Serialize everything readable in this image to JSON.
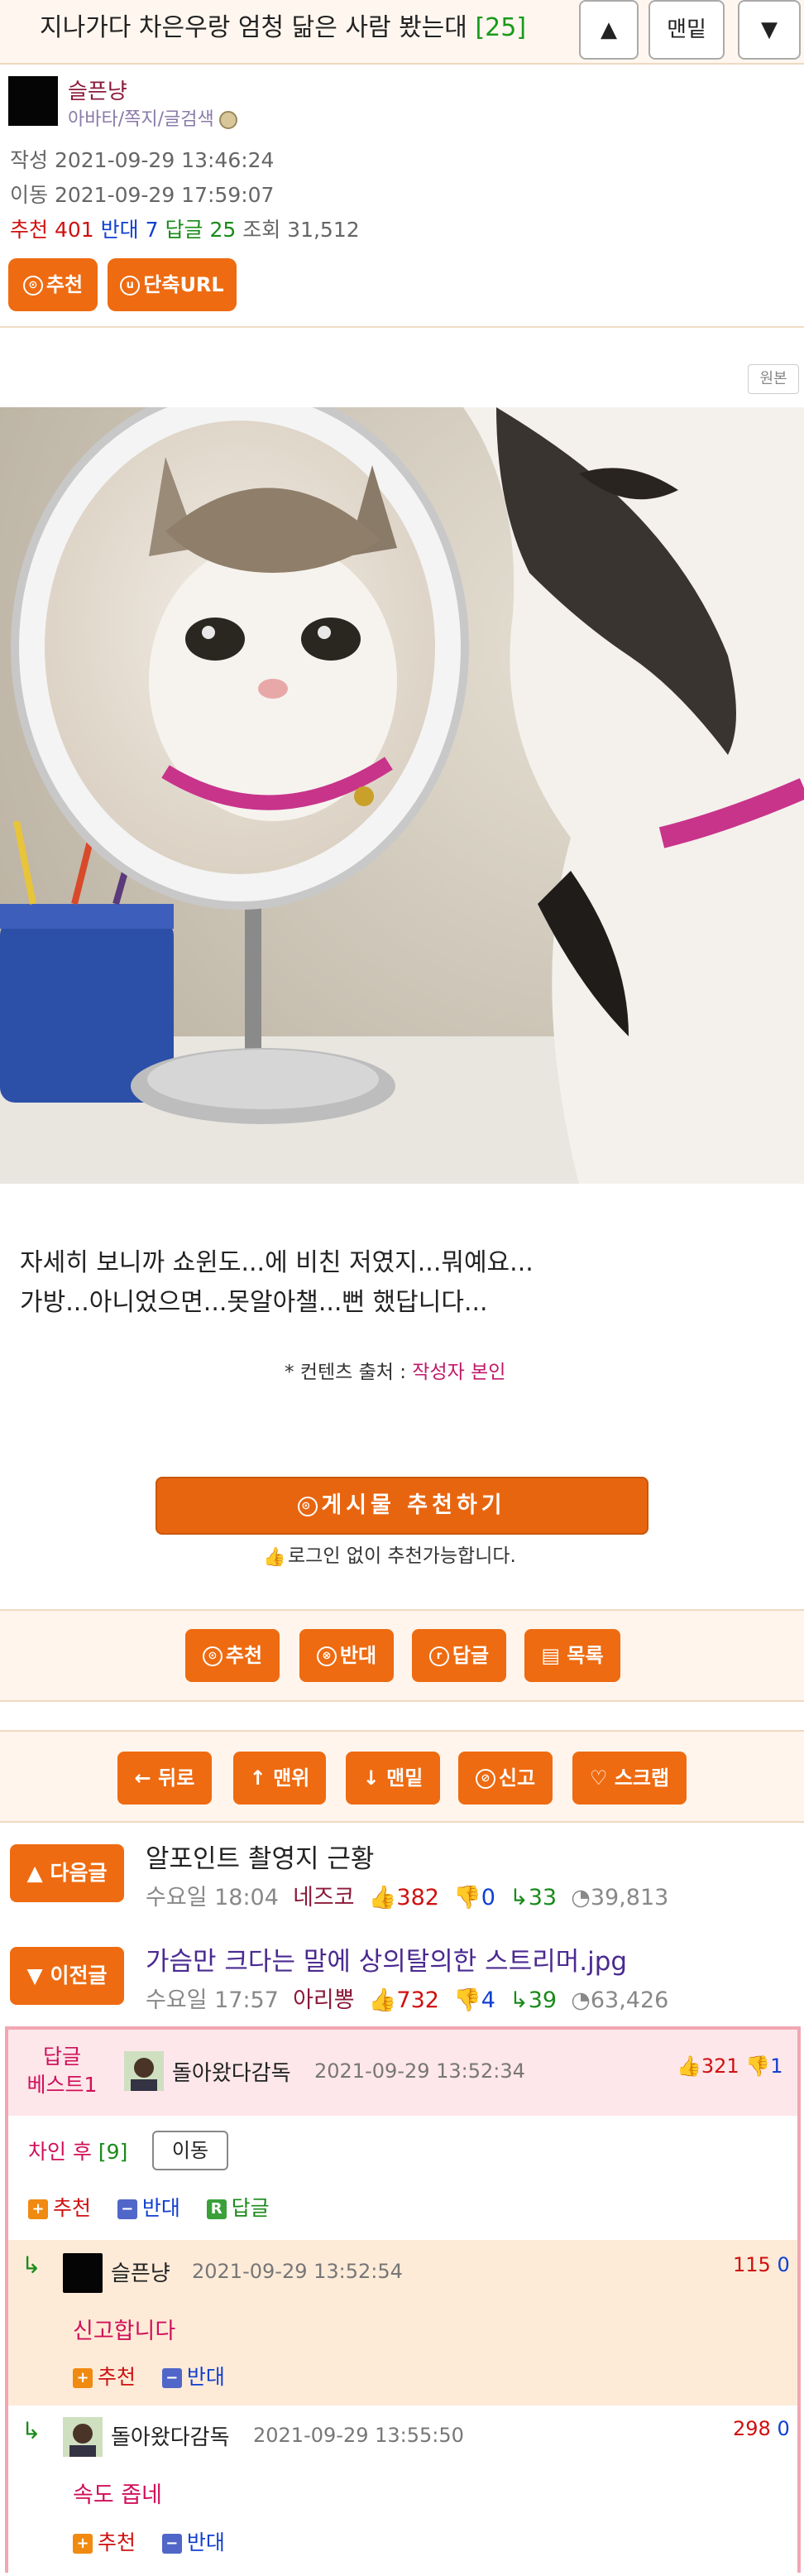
{
  "header": {
    "title": "지나가다 차은우랑 엄청 닮은 사람 봤는대",
    "comment_count": "[25]",
    "up_label": "▲",
    "bottom_label": "맨밑",
    "down_label": "▼"
  },
  "author": {
    "name": "슬픈냥",
    "links": "아바타/쪽지/글검색"
  },
  "meta": {
    "written": "작성 2021-09-29 13:46:24",
    "moved": "이동 2021-09-29 17:59:07",
    "recommend_label": "추천",
    "recommend": "401",
    "oppose_label": "반대",
    "oppose": "7",
    "reply_label": "답글",
    "reply": "25",
    "views_label": "조회",
    "views": "31,512"
  },
  "actions": {
    "recommend": "추천",
    "short_url": "단축URL"
  },
  "original_label": "원본",
  "content": {
    "line1": "자세히 보니까 쇼윈도...에 비친 저였지...뭐예요...",
    "line2": "가방...아니었으면...못알아챌...뻔 했답니다...",
    "source_prefix": "* 컨텐츠 출처 : ",
    "source_link": "작성자 본인"
  },
  "recommend_box": {
    "button": "게시물 추천하기",
    "note": "로그인 없이 추천가능합니다."
  },
  "bar1": [
    "추천",
    "반대",
    "답글",
    "목록"
  ],
  "bar2": [
    "뒤로",
    "맨위",
    "맨밑",
    "신고",
    "스크랩"
  ],
  "next_post": {
    "tag": "다음글",
    "title": "알포인트 촬영지 근황",
    "time": "수요일 18:04",
    "nick": "네즈코",
    "up": "382",
    "down": "0",
    "replies": "33",
    "views": "39,813"
  },
  "prev_post": {
    "tag": "이전글",
    "title": "가슴만 크다는 말에 상의탈의한 스트리머.jpg",
    "time": "수요일 17:57",
    "nick": "아리뽕",
    "up": "732",
    "down": "4",
    "replies": "39",
    "views": "63,426"
  },
  "best_comment": {
    "label1": "답글",
    "label2": "베스트1",
    "nick": "돌아왔다감독",
    "date": "2021-09-29 13:52:34",
    "up": "321",
    "down": "1",
    "text": "차인 후",
    "count": "[9]",
    "move": "이동",
    "act_up": "추천",
    "act_down": "반대",
    "act_reply": "답글"
  },
  "replies": [
    {
      "nick": "슬픈냥",
      "date": "2021-09-29 13:52:54",
      "up": "115",
      "down": "0",
      "text": "신고합니다",
      "act_up": "추천",
      "act_down": "반대"
    },
    {
      "nick": "돌아왔다감독",
      "date": "2021-09-29 13:55:50",
      "up": "298",
      "down": "0",
      "text": "속도 좁네",
      "act_up": "추천",
      "act_down": "반대"
    }
  ],
  "colors": {
    "accent": "#ee6b11",
    "nick": "#8b1a3a",
    "best_border": "#f2a6b4"
  }
}
